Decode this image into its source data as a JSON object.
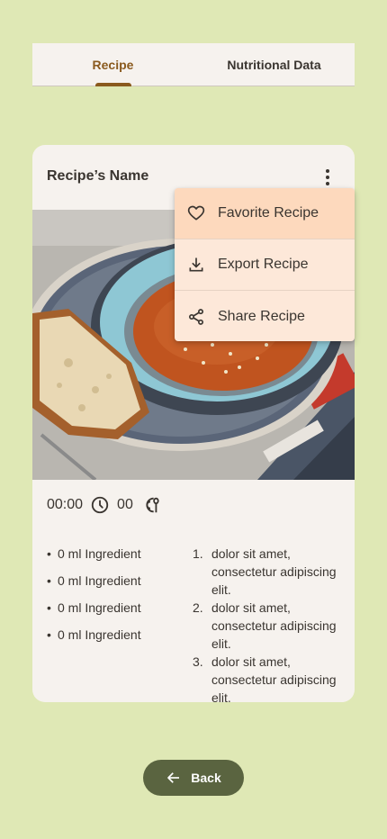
{
  "tabs": [
    {
      "label": "Recipe",
      "active": true
    },
    {
      "label": "Nutritional Data",
      "active": false
    }
  ],
  "card": {
    "title": "Recipe’s Name",
    "more_icon": "more-vert-icon",
    "image": "soup-bowl-photo"
  },
  "meta": {
    "time": "00:00",
    "time_icon": "clock-icon",
    "servings": "00",
    "servings_icon": "serving-icon"
  },
  "ingredients": [
    "0 ml Ingredient",
    "0 ml Ingredient",
    "0 ml Ingredient",
    "0 ml Ingredient"
  ],
  "steps": [
    {
      "num": "1.",
      "text": "dolor sit amet, consectetur adipiscing elit."
    },
    {
      "num": "2.",
      "text": "dolor sit amet, consectetur adipiscing elit."
    },
    {
      "num": "3.",
      "text": "dolor sit amet, consectetur adipiscing elit."
    }
  ],
  "menu": {
    "items": [
      {
        "label": "Favorite Recipe",
        "icon": "heart-icon"
      },
      {
        "label": "Export Recipe",
        "icon": "download-icon"
      },
      {
        "label": "Share Recipe",
        "icon": "share-icon"
      }
    ]
  },
  "back_button": {
    "label": "Back",
    "icon": "arrow-back-icon"
  },
  "colors": {
    "background": "#dfe8b5",
    "surface": "#f6f2ee",
    "accent": "#8a5a1e",
    "menu": "#fde8d9",
    "button": "#5a6440"
  }
}
